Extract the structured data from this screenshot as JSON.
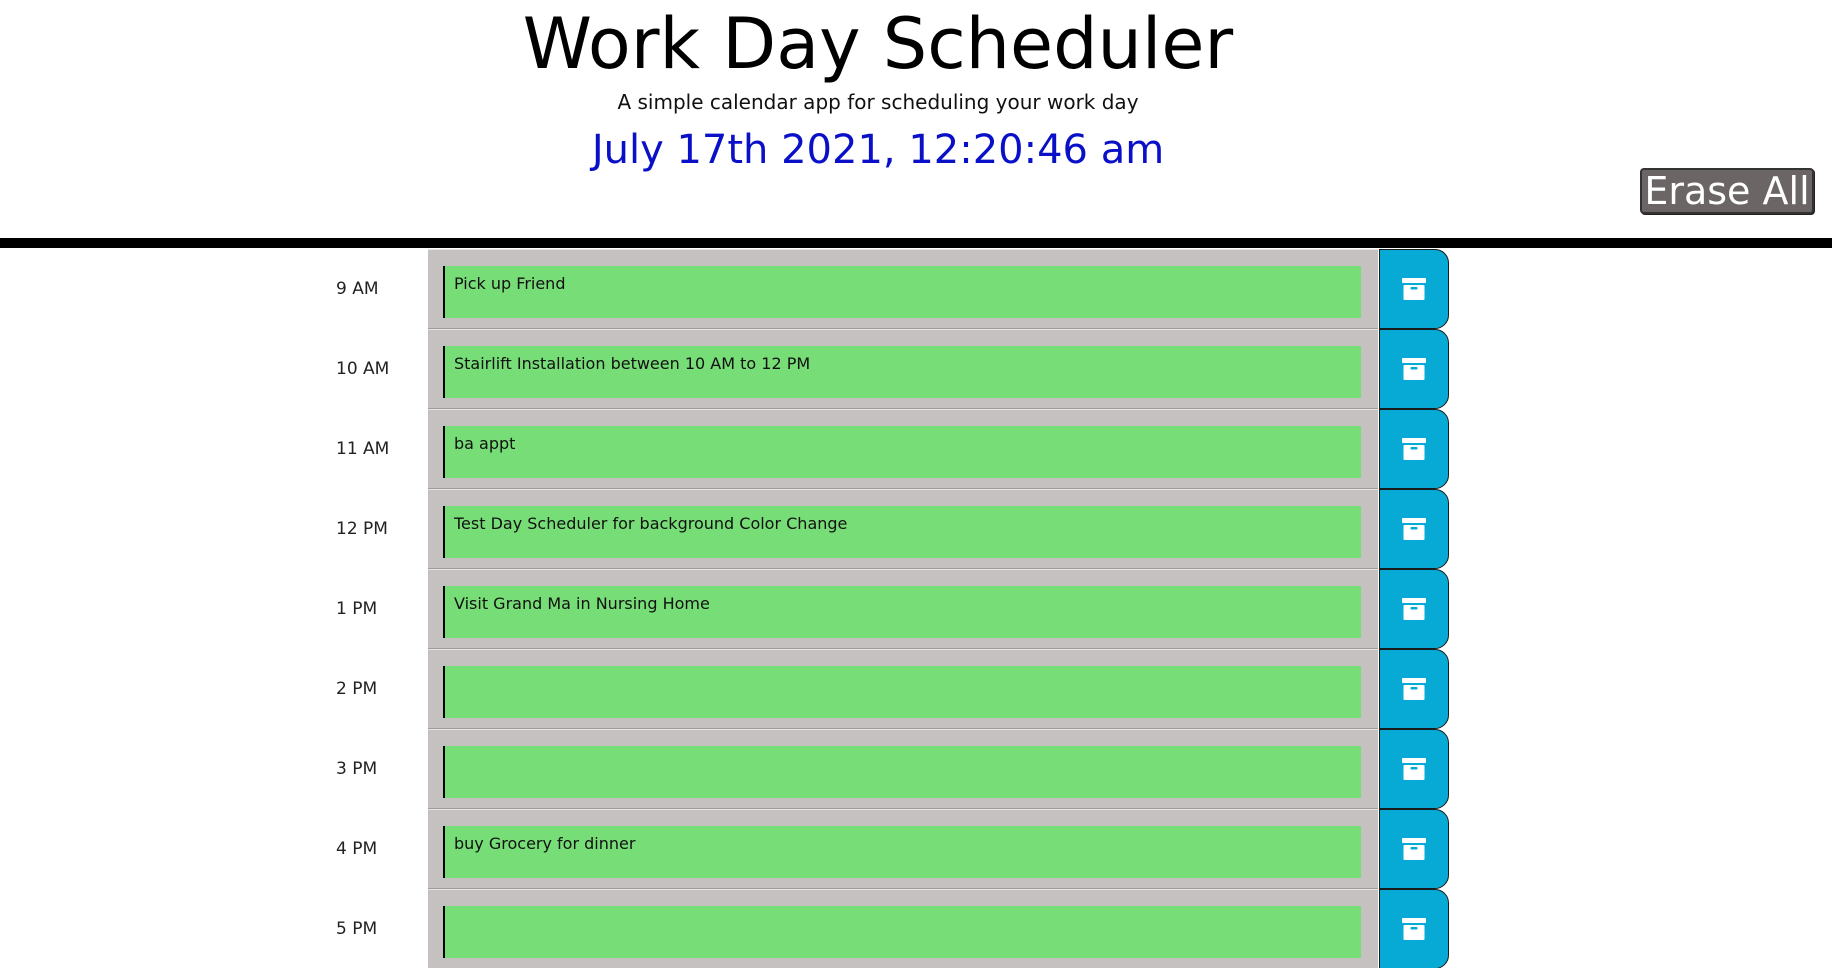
{
  "header": {
    "title": "Work Day Scheduler",
    "subtitle": "A simple calendar app for scheduling your work day",
    "current_date": "July 17th 2021, 12:20:46 am",
    "erase_all_label": "Erase All"
  },
  "colors": {
    "date_text": "#0a10c8",
    "future_slot": "#77dd77",
    "save_button": "#06aad5",
    "erase_button": "#6b6565",
    "slot_background": "#c4c1c0"
  },
  "schedule": [
    {
      "hour": "9 AM",
      "event": "Pick up Friend",
      "save_icon": "archive-box-icon"
    },
    {
      "hour": "10 AM",
      "event": "Stairlift Installation between 10 AM  to 12 PM",
      "save_icon": "archive-box-icon"
    },
    {
      "hour": "11 AM",
      "event": "ba appt",
      "save_icon": "archive-box-icon"
    },
    {
      "hour": "12 PM",
      "event": "Test Day Scheduler for background Color Change",
      "save_icon": "archive-box-icon"
    },
    {
      "hour": "1 PM",
      "event": "Visit Grand Ma in Nursing Home",
      "save_icon": "archive-box-icon"
    },
    {
      "hour": "2 PM",
      "event": "",
      "save_icon": "archive-box-icon"
    },
    {
      "hour": "3 PM",
      "event": "",
      "save_icon": "archive-box-icon"
    },
    {
      "hour": "4 PM",
      "event": "buy Grocery for dinner",
      "save_icon": "archive-box-icon"
    },
    {
      "hour": "5 PM",
      "event": "",
      "save_icon": "archive-box-icon"
    }
  ]
}
